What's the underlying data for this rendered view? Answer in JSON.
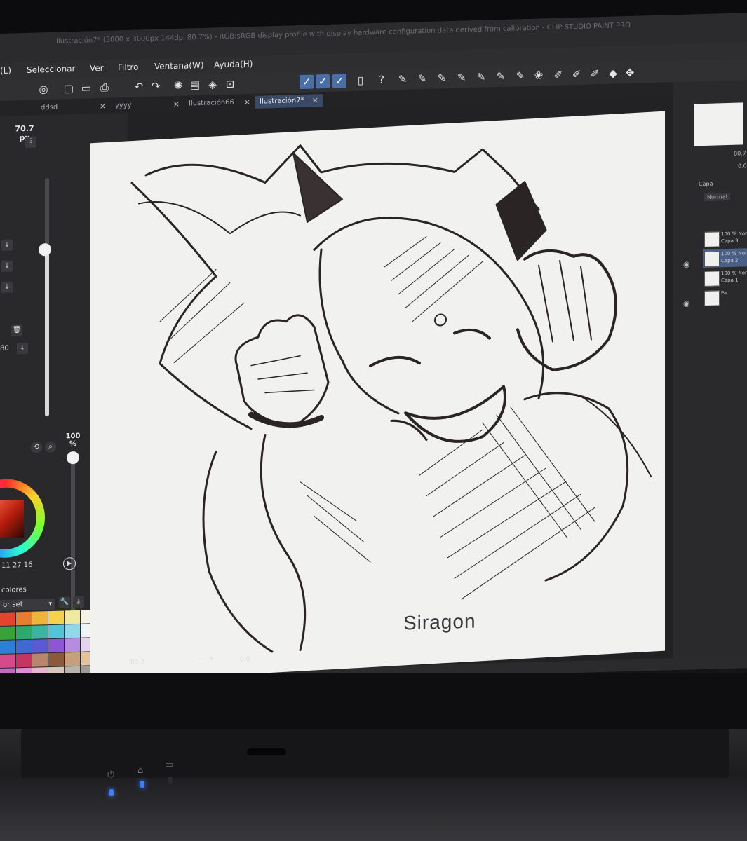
{
  "window": {
    "title": "Ilustración7* (3000 x 3000px 144dpi 80.7%) - RGB:sRGB display profile with display hardware configuration data derived from calibration - CLIP STUDIO PAINT PRO"
  },
  "menu": {
    "items": [
      "(L)",
      "Seleccionar",
      "Ver",
      "Filtro",
      "Ventana(W)",
      "Ayuda(H)"
    ]
  },
  "tabs": [
    {
      "label": "ddsd",
      "close": "×"
    },
    {
      "label": "yyyy",
      "close": "×"
    },
    {
      "label": "Ilustración66",
      "close": "×"
    },
    {
      "label": "Ilustración7*",
      "close": "×"
    }
  ],
  "left_panel": {
    "brush_size_value": "70.7",
    "brush_size_unit": "px",
    "opacity_value": "100",
    "opacity_unit": "%",
    "brush_size_level": 0.7,
    "opacity_level": 1.0,
    "wheel_numbers": "11  27  16",
    "palette_label": "colores",
    "color_set": "or set",
    "zoom_value": "80.7",
    "side_value": "80",
    "swatches": [
      "#e6432e",
      "#e57f2f",
      "#f1b33c",
      "#f4d24b",
      "#f0e9a2",
      "#f5f3e7",
      "#38a13a",
      "#2ca96b",
      "#39b5a2",
      "#52c4d6",
      "#8fd7e9",
      "#f0f5f7",
      "#2b7fd6",
      "#3e6bd2",
      "#5a5bd4",
      "#8c56d6",
      "#b68be0",
      "#e3d4f0",
      "#d64a8c",
      "#c43561",
      "#b8856d",
      "#8b5a3c",
      "#c5a07a",
      "#e2c39b",
      "#c06dc0",
      "#d891d8",
      "#e7b6cc",
      "#d8c5bb",
      "#b9b3ac",
      "#a09c96"
    ]
  },
  "canvas": {
    "zoom": "80.7",
    "rotate": "0.0"
  },
  "right_panel": {
    "navigator_zoom": "80.7",
    "navigator_rotate": "0.0",
    "layer_panel_label": "Capa",
    "blend_mode": "Normal",
    "layers": [
      {
        "opacity": "100 % Nor",
        "name": "Capa 3"
      },
      {
        "opacity": "100 % Nor",
        "name": "Capa 2"
      },
      {
        "opacity": "100 % Nor",
        "name": "Capa 1"
      },
      {
        "opacity": "",
        "name": "Pa"
      }
    ]
  },
  "laptop": {
    "brand": "Siragon",
    "led_color": "#3a7bff"
  },
  "icons": {
    "toolbar": [
      "new-file-icon",
      "open-folder-icon",
      "save-icon",
      "undo-icon",
      "redo-icon",
      "select-all-icon",
      "fill-icon",
      "transform-icon",
      "pen-icon",
      "pen-icon",
      "pen-icon",
      "layer-icon",
      "help-icon",
      "brush-icon",
      "brush-icon",
      "brush-icon",
      "brush-icon",
      "brush-icon",
      "brush-icon",
      "brush-icon",
      "water-icon",
      "marker-icon",
      "marker-icon",
      "marker-icon",
      "eraser-icon",
      "move-icon"
    ]
  }
}
